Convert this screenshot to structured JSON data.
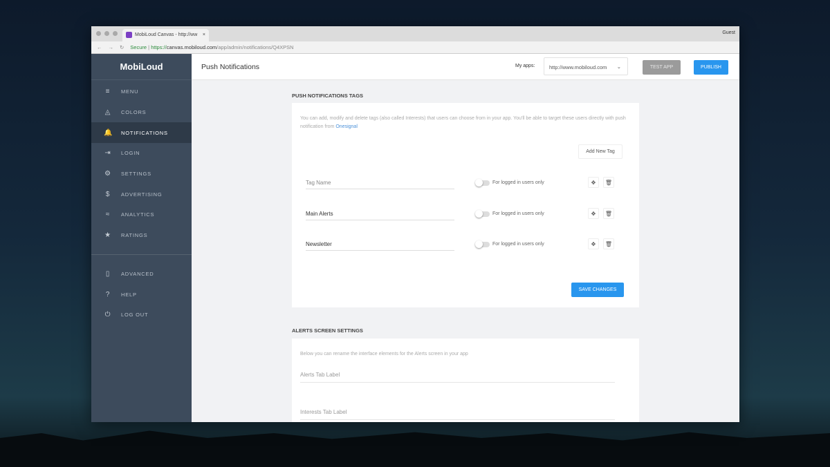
{
  "browser": {
    "tab_title": "MobiLoud Canvas - http://ww",
    "user": "Guest",
    "secure": "Secure",
    "url_scheme": "https://",
    "url_host": "canvas.mobiloud.com",
    "url_path": "/app/admin/notifications/Q4XPSN"
  },
  "sidebar": {
    "logo": "MobiLoud",
    "items": [
      {
        "label": "MENU",
        "icon": "≡"
      },
      {
        "label": "COLORS",
        "icon": "◬"
      },
      {
        "label": "NOTIFICATIONS",
        "icon": "🔔"
      },
      {
        "label": "LOGIN",
        "icon": "⇥"
      },
      {
        "label": "SETTINGS",
        "icon": "⚙"
      },
      {
        "label": "ADVERTISING",
        "icon": "$"
      },
      {
        "label": "ANALYTICS",
        "icon": "≈"
      },
      {
        "label": "RATINGS",
        "icon": "★"
      }
    ],
    "bottom_items": [
      {
        "label": "ADVANCED",
        "icon": "▯"
      },
      {
        "label": "HELP",
        "icon": "?"
      },
      {
        "label": "LOG OUT",
        "icon": "⏻"
      }
    ]
  },
  "header": {
    "title": "Push Notifications",
    "my_apps_label": "My apps:",
    "selected_app": "http://www.mobiloud.com",
    "test_label": "TEST APP",
    "publish_label": "PUBLISH"
  },
  "tags_section": {
    "heading": "PUSH NOTIFICATIONS TAGS",
    "description": "You can add, modify and delete tags (also called Interests) that users can choose from in your app. You'll be able to target these users directly with push notification from ",
    "link": "Onesignal",
    "add_label": "Add New Tag",
    "rows": [
      {
        "name": "Tag Name",
        "placeholder": true,
        "toggle_label": "For logged in users only"
      },
      {
        "name": "Main Alerts",
        "toggle_label": "For logged in users only"
      },
      {
        "name": "Newsletter",
        "toggle_label": "For logged in users only"
      }
    ],
    "save_label": "SAVE CHANGES"
  },
  "alerts_section": {
    "heading": "ALERTS SCREEN SETTINGS",
    "description": "Below you can rename the interface elements for the Alerts screen in your app",
    "fields": [
      "Alerts Tab Label",
      "Interests Tab Label"
    ]
  }
}
